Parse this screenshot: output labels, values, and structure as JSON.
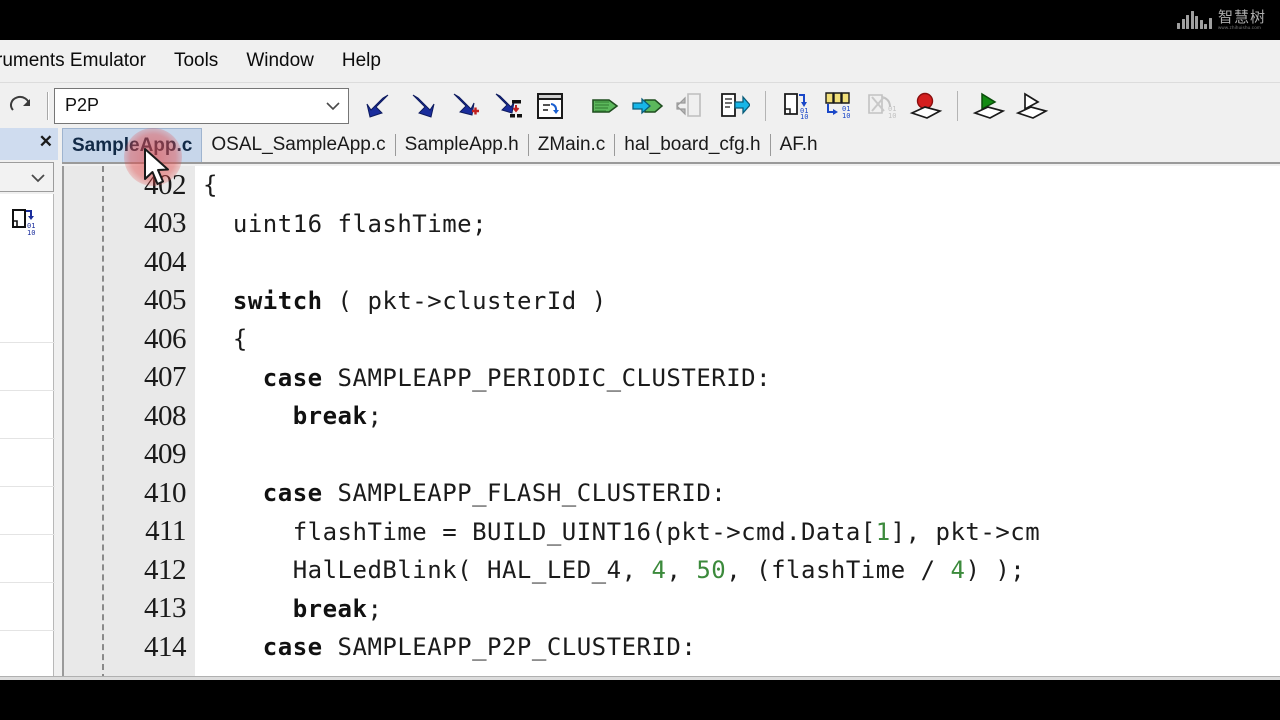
{
  "watermark": {
    "cn": "智慧树",
    "url": "www.zhihuishu.com",
    "bars": [
      6,
      10,
      14,
      18,
      13,
      9,
      5,
      11
    ]
  },
  "menubar": {
    "items": [
      {
        "label": "ruments Emulator",
        "clipped": true
      },
      {
        "label": "Tools",
        "clipped": false
      },
      {
        "label": "Window",
        "clipped": false
      },
      {
        "label": "Help",
        "clipped": false
      }
    ]
  },
  "toolbar": {
    "redo_icon": "redo-arrow-icon",
    "combo": {
      "value": "P2P",
      "placeholder": "P2P",
      "arrow": "chevron-down-icon"
    },
    "buttons": [
      {
        "name": "make-icon",
        "tip": "Make"
      },
      {
        "name": "compile-icon",
        "tip": "Compile"
      },
      {
        "name": "add-files-icon",
        "tip": "Add Files"
      },
      {
        "name": "batch-build-icon",
        "tip": "Batch Build"
      },
      {
        "name": "edit-configurations-icon",
        "tip": "Edit Configurations"
      },
      {
        "name": "tag-icon",
        "tip": "Bookmark"
      },
      {
        "name": "next-tag-icon",
        "tip": "Go To Bookmark"
      },
      {
        "name": "prev-doc-icon",
        "tip": "Previous Document",
        "disabled": true
      },
      {
        "name": "next-doc-icon",
        "tip": "Next Document"
      },
      {
        "name": "download-active-app-icon",
        "tip": "Download Active Application"
      },
      {
        "name": "download-all-icon",
        "tip": "Download All"
      },
      {
        "name": "debug-without-download-icon",
        "tip": "Debug Without Downloading",
        "disabled": true
      },
      {
        "name": "stop-debugger-icon",
        "tip": "Stop Debugger"
      },
      {
        "name": "go-icon",
        "tip": "Go"
      },
      {
        "name": "step-icon",
        "tip": "Step"
      }
    ]
  },
  "leftpanel": {
    "close_label": "✕",
    "combo_arrow": "chevron-down-icon",
    "icon": "download-file-icon"
  },
  "tabs": [
    {
      "label": "SampleApp.c",
      "active": true
    },
    {
      "label": "OSAL_SampleApp.c",
      "active": false
    },
    {
      "label": "SampleApp.h",
      "active": false
    },
    {
      "label": "ZMain.c",
      "active": false
    },
    {
      "label": "hal_board_cfg.h",
      "active": false
    },
    {
      "label": "AF.h",
      "active": false
    }
  ],
  "editor": {
    "first_line": 402,
    "lines": [
      {
        "no": "402",
        "tokens": [
          {
            "t": "{",
            "c": "sym"
          }
        ]
      },
      {
        "no": "403",
        "tokens": [
          {
            "t": "  uint16 flashTime;",
            "c": "sym"
          }
        ]
      },
      {
        "no": "404",
        "tokens": [
          {
            "t": "",
            "c": "sym"
          }
        ]
      },
      {
        "no": "405",
        "tokens": [
          {
            "t": "  ",
            "c": "sym"
          },
          {
            "t": "switch",
            "c": "kw"
          },
          {
            "t": " ( pkt->clusterId )",
            "c": "sym"
          }
        ]
      },
      {
        "no": "406",
        "tokens": [
          {
            "t": "  {",
            "c": "sym"
          }
        ]
      },
      {
        "no": "407",
        "tokens": [
          {
            "t": "    ",
            "c": "sym"
          },
          {
            "t": "case",
            "c": "kw"
          },
          {
            "t": " SAMPLEAPP_PERIODIC_CLUSTERID:",
            "c": "sym"
          }
        ]
      },
      {
        "no": "408",
        "tokens": [
          {
            "t": "      ",
            "c": "sym"
          },
          {
            "t": "break",
            "c": "kw"
          },
          {
            "t": ";",
            "c": "sym"
          }
        ]
      },
      {
        "no": "409",
        "tokens": [
          {
            "t": "",
            "c": "sym"
          }
        ]
      },
      {
        "no": "410",
        "tokens": [
          {
            "t": "    ",
            "c": "sym"
          },
          {
            "t": "case",
            "c": "kw"
          },
          {
            "t": " SAMPLEAPP_FLASH_CLUSTERID:",
            "c": "sym"
          }
        ]
      },
      {
        "no": "411",
        "tokens": [
          {
            "t": "      flashTime = BUILD_UINT16(pkt->cmd.Data[",
            "c": "sym"
          },
          {
            "t": "1",
            "c": "num"
          },
          {
            "t": "], pkt->cm",
            "c": "sym"
          }
        ]
      },
      {
        "no": "412",
        "tokens": [
          {
            "t": "      HalLedBlink( HAL_LED_4, ",
            "c": "sym"
          },
          {
            "t": "4",
            "c": "num"
          },
          {
            "t": ", ",
            "c": "sym"
          },
          {
            "t": "50",
            "c": "num"
          },
          {
            "t": ", (flashTime / ",
            "c": "sym"
          },
          {
            "t": "4",
            "c": "num"
          },
          {
            "t": ") );",
            "c": "sym"
          }
        ]
      },
      {
        "no": "413",
        "tokens": [
          {
            "t": "      ",
            "c": "sym"
          },
          {
            "t": "break",
            "c": "kw"
          },
          {
            "t": ";",
            "c": "sym"
          }
        ]
      },
      {
        "no": "414",
        "tokens": [
          {
            "t": "    ",
            "c": "sym"
          },
          {
            "t": "case",
            "c": "kw"
          },
          {
            "t": " SAMPLEAPP_P2P_CLUSTERID:",
            "c": "sym"
          }
        ]
      }
    ]
  },
  "colors": {
    "keyword": "#111111",
    "number": "#3c8a3c",
    "gutter_bg": "#e9e9e9",
    "active_tab_bg": "#c7d6ea",
    "click_highlight": "#e24848",
    "chrome_bg": "#f0f0f0"
  }
}
